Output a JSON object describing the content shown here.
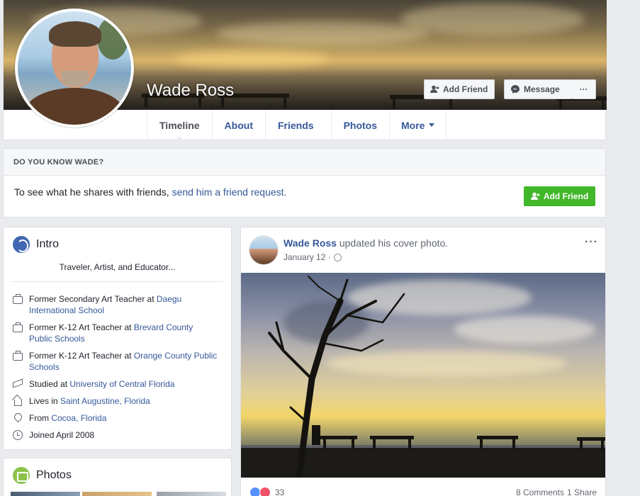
{
  "profile": {
    "name": "Wade Ross"
  },
  "header_actions": {
    "add_friend": "Add Friend",
    "message": "Message",
    "more": "···"
  },
  "tabs": [
    {
      "label": "Timeline",
      "active": true
    },
    {
      "label": "About"
    },
    {
      "label": "Friends"
    },
    {
      "label": "Photos"
    },
    {
      "label": "More"
    }
  ],
  "know": {
    "heading": "DO YOU KNOW WADE?",
    "text": "To see what he shares with friends, ",
    "link": "send him a friend request.",
    "button": "Add Friend"
  },
  "intro": {
    "title": "Intro",
    "bio": "Traveler, Artist, and Educator...",
    "items": [
      {
        "icon": "work-icon",
        "text": "Former Secondary Art Teacher at ",
        "link": "Daegu International School"
      },
      {
        "icon": "work-icon",
        "text": "Former K-12 Art Teacher at ",
        "link": "Brevard County Public Schools"
      },
      {
        "icon": "work-icon",
        "text": "Former K-12 Art Teacher at ",
        "link": "Orange County Public Schools"
      },
      {
        "icon": "education-icon",
        "text": "Studied at ",
        "link": "University of Central Florida"
      },
      {
        "icon": "home-icon",
        "text": "Lives in ",
        "link": "Saint Augustine, Florida"
      },
      {
        "icon": "location-pin-icon",
        "text": "From ",
        "link": "Cocoa, Florida"
      },
      {
        "icon": "clock-icon",
        "text": "Joined April 2008",
        "link": ""
      }
    ]
  },
  "photos_card": {
    "title": "Photos"
  },
  "post": {
    "author": "Wade Ross",
    "action": " updated his cover photo.",
    "date": "January 12 · ",
    "more": "···",
    "reaction_count": "33",
    "comments": "8 Comments",
    "shares": "1 Share"
  },
  "colors": {
    "link": "#365899",
    "green_button": "#42b72a",
    "background": "#e9ebee"
  }
}
